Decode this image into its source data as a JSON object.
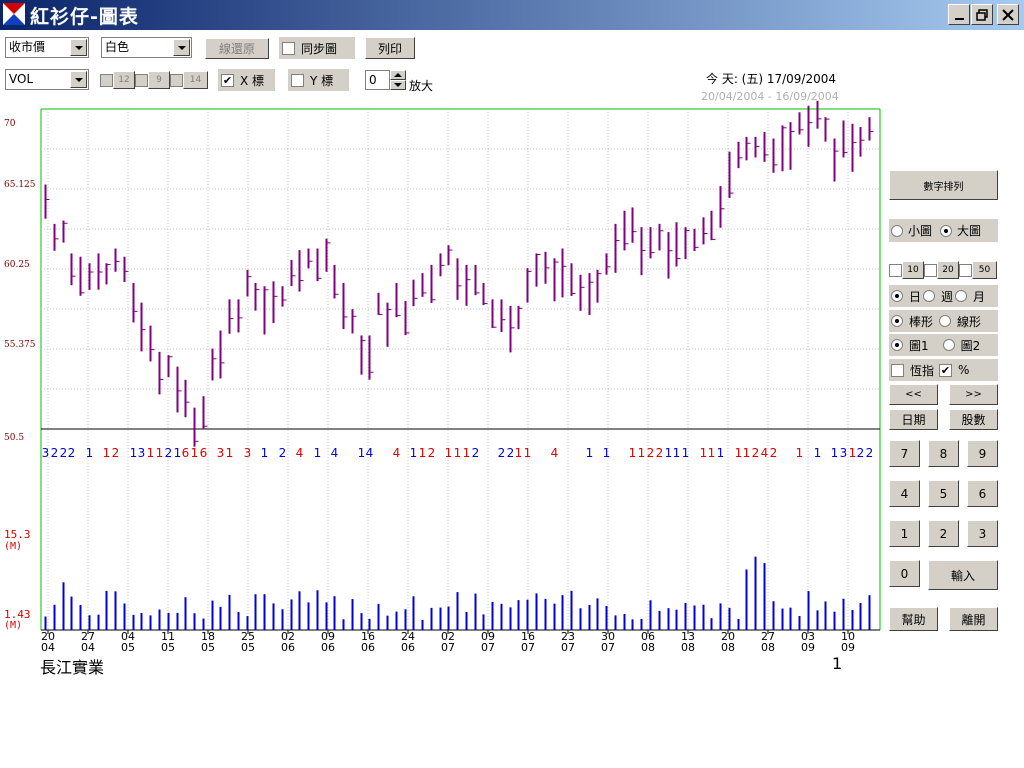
{
  "window": {
    "title": "紅衫仔-圖表"
  },
  "toolbar": {
    "price_select": "收市價",
    "color_select": "白色",
    "restore_lines": "線還原",
    "sync_chart": "同步圖",
    "print": "列印",
    "indicator_select": "VOL",
    "ma_12": "12",
    "ma_9": "9",
    "ma_14": "14",
    "x_axis": "X 標",
    "y_axis": "Y 標",
    "zoom_value": "0",
    "zoom_label": "放大"
  },
  "header": {
    "today": "今 天: (五) 17/09/2004",
    "range": "20/04/2004 - 16/09/2004"
  },
  "sidebar": {
    "digit_list": "數字排列",
    "small_chart": "小圖",
    "large_chart": "大圖",
    "ma10": "10",
    "ma20": "20",
    "ma50": "50",
    "day": "日",
    "week": "週",
    "month": "月",
    "bar": "棒形",
    "line": "線形",
    "chart1": "圖1",
    "chart2": "圖2",
    "hsi": "恆指",
    "percent": "%",
    "prev": "<<",
    "next": ">>",
    "date": "日期",
    "shares": "股數",
    "keypad": [
      "7",
      "8",
      "9",
      "4",
      "5",
      "6",
      "1",
      "2",
      "3",
      "0"
    ],
    "enter": "輸入",
    "help": "幫助",
    "leave": "離開"
  },
  "footer": {
    "stock_name": "長江實業",
    "page": "1"
  },
  "colors": {
    "bar": "#800080",
    "volume": "#0000dd",
    "red_text": "#dd0000",
    "blue_text": "#0000dd"
  },
  "chart_data": {
    "type": "ohlc",
    "price_axis": {
      "ticks": [
        "70",
        "65.125",
        "60.25",
        "55.375",
        "50.5"
      ],
      "ylim": [
        50.5,
        70
      ]
    },
    "volume_axis": {
      "max_label": "15.3",
      "min_label": "1.43",
      "unit_label": "(M)"
    },
    "x_ticks": [
      {
        "day": "20",
        "month": "04"
      },
      {
        "day": "27",
        "month": "04"
      },
      {
        "day": "04",
        "month": "05"
      },
      {
        "day": "11",
        "month": "05"
      },
      {
        "day": "18",
        "month": "05"
      },
      {
        "day": "25",
        "month": "05"
      },
      {
        "day": "02",
        "month": "06"
      },
      {
        "day": "09",
        "month": "06"
      },
      {
        "day": "16",
        "month": "06"
      },
      {
        "day": "24",
        "month": "06"
      },
      {
        "day": "02",
        "month": "07"
      },
      {
        "day": "09",
        "month": "07"
      },
      {
        "day": "16",
        "month": "07"
      },
      {
        "day": "23",
        "month": "07"
      },
      {
        "day": "30",
        "month": "07"
      },
      {
        "day": "06",
        "month": "08"
      },
      {
        "day": "13",
        "month": "08"
      },
      {
        "day": "20",
        "month": "08"
      },
      {
        "day": "27",
        "month": "08"
      },
      {
        "day": "03",
        "month": "09"
      },
      {
        "day": "10",
        "month": "09"
      }
    ],
    "digits": [
      "3",
      "2",
      "2",
      "2",
      "",
      "1",
      "",
      "1",
      "2",
      "",
      "1",
      "3",
      "1",
      "1",
      "2",
      "1",
      "6",
      "1",
      "6",
      "",
      "3",
      "1",
      "",
      "3",
      "",
      "1",
      "",
      "2",
      "",
      "4",
      "",
      "1",
      "",
      "4",
      "",
      "",
      "1",
      "4",
      "",
      "",
      "4",
      "",
      "1",
      "1",
      "2",
      "",
      "1",
      "1",
      "1",
      "2",
      "",
      "",
      "2",
      "2",
      "1",
      "1",
      "",
      "",
      "4",
      "",
      "",
      "",
      "1",
      "",
      "1",
      "",
      "",
      "1",
      "1",
      "2",
      "2",
      "1",
      "1",
      "1",
      "",
      "1",
      "1",
      "1",
      "",
      "1",
      "1",
      "2",
      "4",
      "2",
      "",
      "",
      "1",
      "",
      "1",
      "",
      "1",
      "3",
      "1",
      "2",
      "2",
      "1",
      "1",
      "",
      "1",
      "1"
    ],
    "digit_colors": [
      "b",
      "b",
      "b",
      "b",
      "",
      "b",
      "",
      "r",
      "r",
      "",
      "b",
      "b",
      "r",
      "r",
      "b",
      "b",
      "r",
      "r",
      "r",
      "",
      "r",
      "r",
      "",
      "r",
      "",
      "b",
      "",
      "b",
      "",
      "r",
      "",
      "b",
      "",
      "b",
      "",
      "",
      "b",
      "b",
      "",
      "",
      "r",
      "",
      "b",
      "r",
      "r",
      "",
      "r",
      "r",
      "r",
      "b",
      "",
      "",
      "b",
      "b",
      "r",
      "r",
      "",
      "",
      "r",
      "",
      "",
      "",
      "b",
      "",
      "b",
      "",
      "",
      "r",
      "r",
      "r",
      "r",
      "b",
      "b",
      "b",
      "",
      "r",
      "r",
      "b",
      "",
      "r",
      "r",
      "r",
      "r",
      "r",
      "",
      "",
      "r",
      "",
      "b",
      "",
      "b",
      "b",
      "r",
      "b",
      "b",
      "r",
      "r",
      "",
      "b",
      "b"
    ],
    "high": [
      65.4,
      63.0,
      63.2,
      61.2,
      61.0,
      60.6,
      61.2,
      60.6,
      61.5,
      61.0,
      59.4,
      58.2,
      56.8,
      55.2,
      55.0,
      54.3,
      53.5,
      51.8,
      52.5,
      55.4,
      56.5,
      58.4,
      58.4,
      60.2,
      59.4,
      59.2,
      59.5,
      59.2,
      60.8,
      61.4,
      61.5,
      61.5,
      62.1,
      60.5,
      59.4,
      57.8,
      56.2,
      56.2,
      58.8,
      58.2,
      59.4,
      58.3,
      59.6,
      60.0,
      60.5,
      61.2,
      61.7,
      60.9,
      60.5,
      60.5,
      59.4,
      58.4,
      58.4,
      58.0,
      58.0,
      60.3,
      61.2,
      61.3,
      60.9,
      61.5,
      60.6,
      59.9,
      60.0,
      60.2,
      61.2,
      63.0,
      63.8,
      64.0,
      62.8,
      62.8,
      63.0,
      62.5,
      63.1,
      62.8,
      62.7,
      63.4,
      63.8,
      65.3,
      67.4,
      68.0,
      68.3,
      68.3,
      68.6,
      68.2,
      69.0,
      69.2,
      69.8,
      70.2,
      70.5,
      69.5,
      68.2,
      69.3,
      69.1,
      68.9,
      69.5
    ]
  }
}
